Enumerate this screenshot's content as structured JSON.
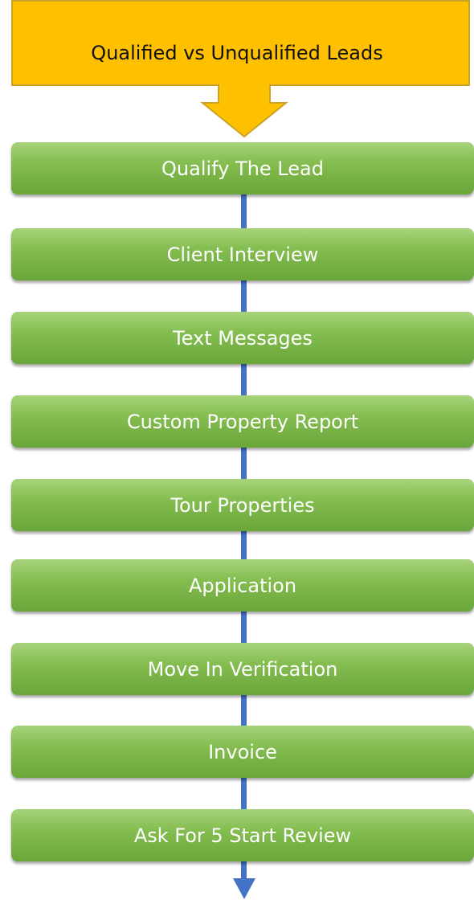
{
  "header": {
    "title": "Qualified vs Unqualified Leads"
  },
  "steps": [
    {
      "label": "Qualify The Lead"
    },
    {
      "label": "Client Interview"
    },
    {
      "label": "Text Messages"
    },
    {
      "label": "Custom Property Report"
    },
    {
      "label": "Tour Properties"
    },
    {
      "label": "Application"
    },
    {
      "label": "Move In Verification"
    },
    {
      "label": "Invoice"
    },
    {
      "label": "Ask For 5 Start Review"
    }
  ],
  "colors": {
    "callout_fill": "#ffc000",
    "callout_border": "#c9a227",
    "step_fill": "#70ad47",
    "connector": "#4472c4"
  }
}
